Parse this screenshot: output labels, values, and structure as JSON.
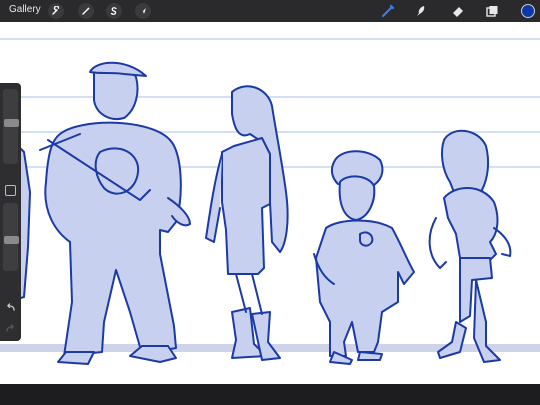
{
  "app": {
    "gallery_label": "Gallery"
  },
  "toolbar_left": {
    "items": [
      {
        "name": "actions",
        "icon": "wrench-icon"
      },
      {
        "name": "adjustments",
        "icon": "magic-wand-icon"
      },
      {
        "name": "selection",
        "icon": "selection-s-icon"
      },
      {
        "name": "transform",
        "icon": "arrow-cursor-icon"
      }
    ]
  },
  "toolbar_right": {
    "items": [
      {
        "name": "brush",
        "icon": "brush-icon",
        "active": true
      },
      {
        "name": "smudge",
        "icon": "smudge-icon",
        "active": false
      },
      {
        "name": "eraser",
        "icon": "eraser-icon",
        "active": false
      },
      {
        "name": "layers",
        "icon": "layers-icon",
        "active": false
      }
    ],
    "current_color": "#0b3aa8"
  },
  "colors": {
    "accent": "#1e56d8",
    "ink": "#1b3aa6",
    "fill": "#c8d0ef",
    "guide": "#c6d5f1",
    "ground": "#cfd3ea",
    "canvas": "#ffffff"
  },
  "sidebar": {
    "brush_size_level": 0.55,
    "opacity_level": 0.45
  }
}
